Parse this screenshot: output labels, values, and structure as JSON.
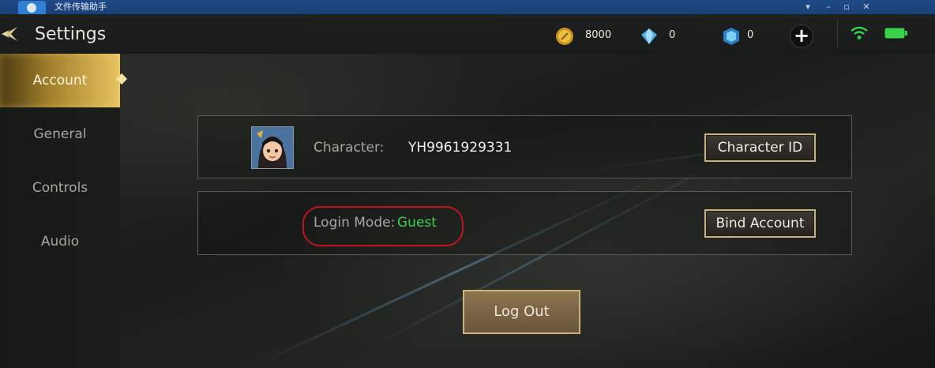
{
  "window": {
    "title": "文件传输助手"
  },
  "header": {
    "title": "Settings",
    "gold": "8000",
    "diamonds": "0",
    "vouchers": "0"
  },
  "sidebar": {
    "items": [
      {
        "label": "Account",
        "active": true
      },
      {
        "label": "General",
        "active": false
      },
      {
        "label": "Controls",
        "active": false
      },
      {
        "label": "Audio",
        "active": false
      }
    ]
  },
  "account": {
    "character_label": "Character:",
    "character_value": "YH9961929331",
    "character_id_button": "Character ID",
    "login_mode_label": "Login Mode:",
    "login_mode_value": "Guest",
    "bind_account_button": "Bind Account",
    "logout_button": "Log Out"
  },
  "colors": {
    "accent_gold": "#c9b37c",
    "guest_green": "#38d24a",
    "highlight_red": "#c2141b"
  }
}
